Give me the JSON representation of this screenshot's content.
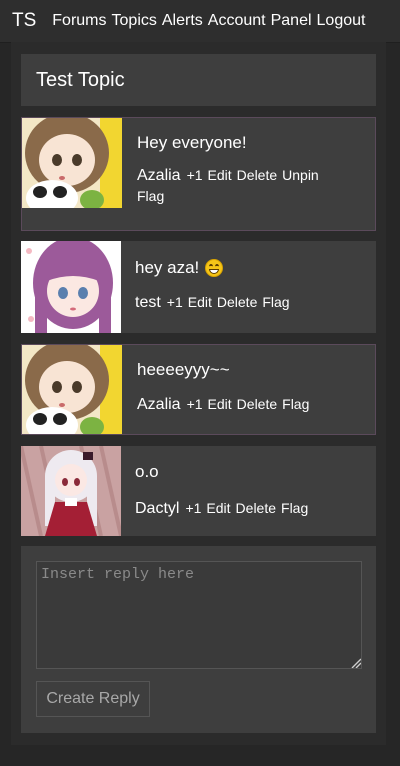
{
  "nav": {
    "brand": "TS",
    "links": [
      "Forums",
      "Topics",
      "Alerts",
      "Account",
      "Panel",
      "Logout"
    ]
  },
  "topic": {
    "title": "Test Topic"
  },
  "posts": [
    {
      "text": "Hey everyone!",
      "user": "Azalia",
      "actions": [
        "+1",
        "Edit",
        "Delete",
        "Unpin",
        "Flag"
      ],
      "avatar": "brown-hair-girl-with-panda"
    },
    {
      "text": "hey aza!",
      "emoji": "grinning-face-icon",
      "user": "test",
      "actions": [
        "+1",
        "Edit",
        "Delete",
        "Flag"
      ],
      "avatar": "purple-hair-girl"
    },
    {
      "text": "heeeeyyy~~",
      "user": "Azalia",
      "actions": [
        "+1",
        "Edit",
        "Delete",
        "Flag"
      ],
      "avatar": "brown-hair-girl-with-panda"
    },
    {
      "text": "o.o",
      "user": "Dactyl",
      "actions": [
        "+1",
        "Edit",
        "Delete",
        "Flag"
      ],
      "avatar": "white-hair-girl-red-dress"
    }
  ],
  "reply": {
    "placeholder": "Insert reply here",
    "button_label": "Create Reply"
  },
  "colors": {
    "page_bg": "#262626",
    "panel_bg": "#2b2b2b",
    "card_bg": "#3e3e3e",
    "own_post_border": "#5b4a5b"
  }
}
